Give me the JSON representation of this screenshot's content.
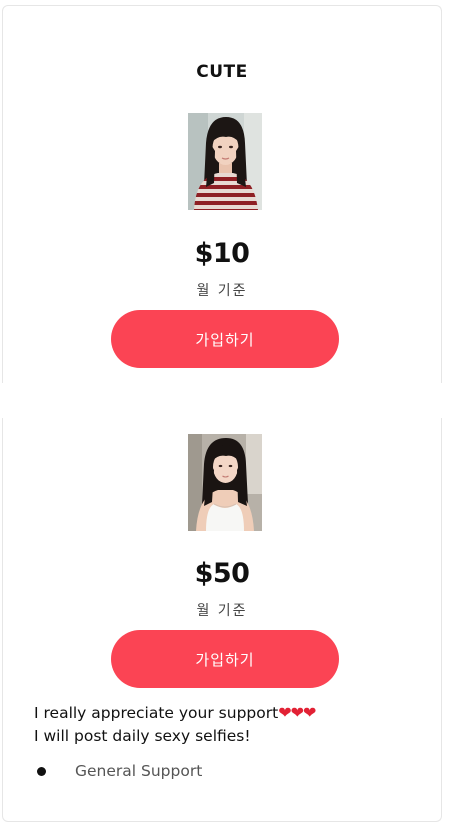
{
  "tiers": [
    {
      "name": "CUTE",
      "price": "$10",
      "period": "월 기준",
      "join_label": "가입하기",
      "thumbnail": "woman-striped-sweater-photo"
    },
    {
      "name": "",
      "price": "$50",
      "period": "월 기준",
      "join_label": "가입하기",
      "thumbnail": "woman-white-top-photo",
      "description_lines": [
        "I really appreciate your support",
        "I will post daily sexy selfies!"
      ],
      "hearts": "❤❤❤",
      "benefits": [
        "General Support"
      ]
    }
  ],
  "colors": {
    "accent": "#fb4454",
    "heart": "#e22134",
    "card_border": "#e6e6e6",
    "muted_text": "#555555"
  }
}
